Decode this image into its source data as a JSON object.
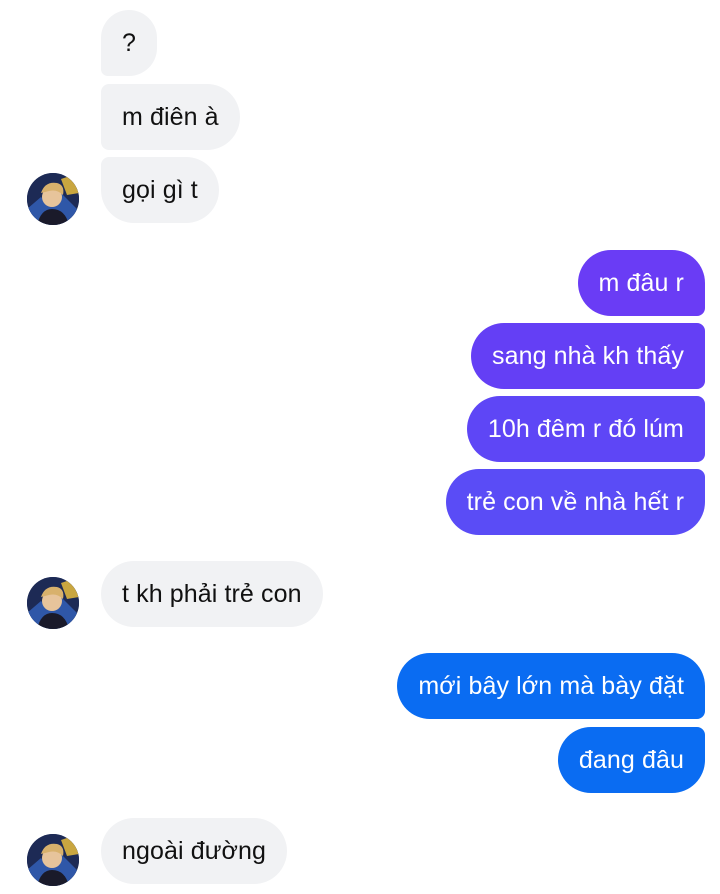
{
  "conversation": {
    "messages": [
      {
        "text": "?",
        "direction": "incoming"
      },
      {
        "text": "m điên à",
        "direction": "incoming"
      },
      {
        "text": "gọi gì t",
        "direction": "incoming"
      },
      {
        "text": "m đâu r",
        "direction": "outgoing"
      },
      {
        "text": "sang nhà kh thấy",
        "direction": "outgoing"
      },
      {
        "text": "10h đêm r đó lúm",
        "direction": "outgoing"
      },
      {
        "text": "trẻ con về nhà hết r",
        "direction": "outgoing"
      },
      {
        "text": "t kh phải trẻ con",
        "direction": "incoming"
      },
      {
        "text": "mới bây lớn mà bày đặt",
        "direction": "outgoing"
      },
      {
        "text": "đang đâu",
        "direction": "outgoing"
      },
      {
        "text": "ngoài đường",
        "direction": "incoming"
      }
    ]
  },
  "colors": {
    "incoming_bubble": "#f1f2f4",
    "incoming_text": "#111111",
    "outgoing_text": "#ffffff",
    "gradient_purple": "#6a3cf5",
    "gradient_violet": "#5b4cf6",
    "gradient_blue": "#0a6cf2"
  },
  "icons": {
    "sender_avatar": "contact-avatar-photo"
  }
}
